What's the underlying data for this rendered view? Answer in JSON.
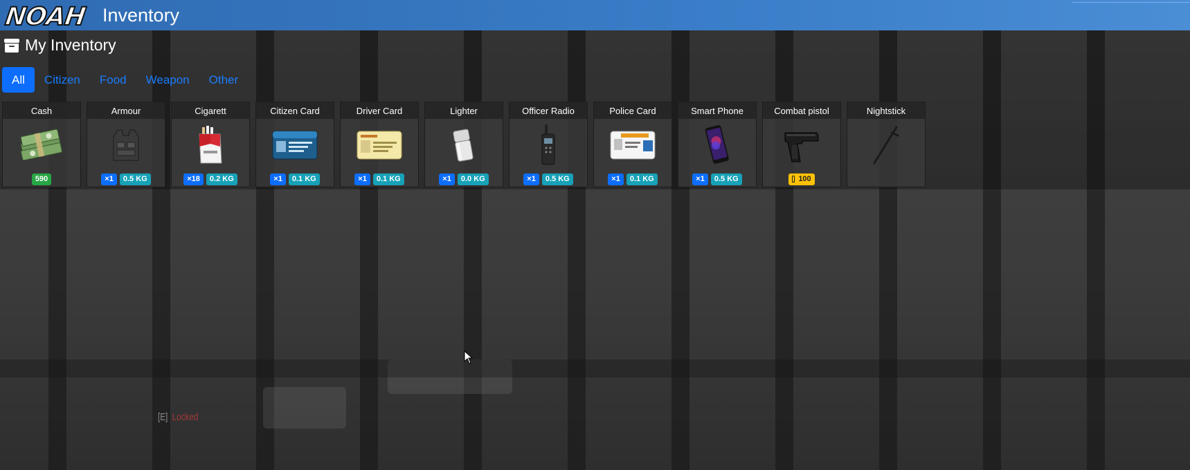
{
  "header": {
    "logo_text": "NOAH",
    "title": "Inventory"
  },
  "section": {
    "icon": "archive-box-icon",
    "title": "My Inventory"
  },
  "tabs": [
    {
      "label": "All",
      "active": true
    },
    {
      "label": "Citizen",
      "active": false
    },
    {
      "label": "Food",
      "active": false
    },
    {
      "label": "Weapon",
      "active": false
    },
    {
      "label": "Other",
      "active": false
    }
  ],
  "items": [
    {
      "name": "Cash",
      "icon": "cash-stack-icon",
      "amount": "590"
    },
    {
      "name": "Armour",
      "icon": "armour-vest-icon",
      "count": "×1",
      "weight": "0.5 KG"
    },
    {
      "name": "Cigarett",
      "icon": "cigarette-pack-icon",
      "count": "×18",
      "weight": "0.2 KG"
    },
    {
      "name": "Citizen Card",
      "icon": "citizen-card-icon",
      "count": "×1",
      "weight": "0.1 KG"
    },
    {
      "name": "Driver Card",
      "icon": "driver-card-icon",
      "count": "×1",
      "weight": "0.1 KG"
    },
    {
      "name": "Lighter",
      "icon": "lighter-icon",
      "count": "×1",
      "weight": "0.0 KG"
    },
    {
      "name": "Officer Radio",
      "icon": "radio-icon",
      "count": "×1",
      "weight": "0.5 KG"
    },
    {
      "name": "Police Card",
      "icon": "police-card-icon",
      "count": "×1",
      "weight": "0.1 KG"
    },
    {
      "name": "Smart Phone",
      "icon": "smartphone-icon",
      "count": "×1",
      "weight": "0.5 KG"
    },
    {
      "name": "Combat pistol",
      "icon": "pistol-icon",
      "ammo": "100"
    },
    {
      "name": "Nightstick",
      "icon": "nightstick-icon"
    }
  ],
  "prompt": {
    "key": "[E]",
    "state": "Locked"
  },
  "colors": {
    "header": "#3a7dc8",
    "tab_active": "#0d6efd",
    "tab_text": "#1a7cff",
    "badge_count": "#0d6efd",
    "badge_weight": "#17a2b8",
    "badge_cash": "#28a745",
    "badge_ammo": "#ffc107"
  }
}
